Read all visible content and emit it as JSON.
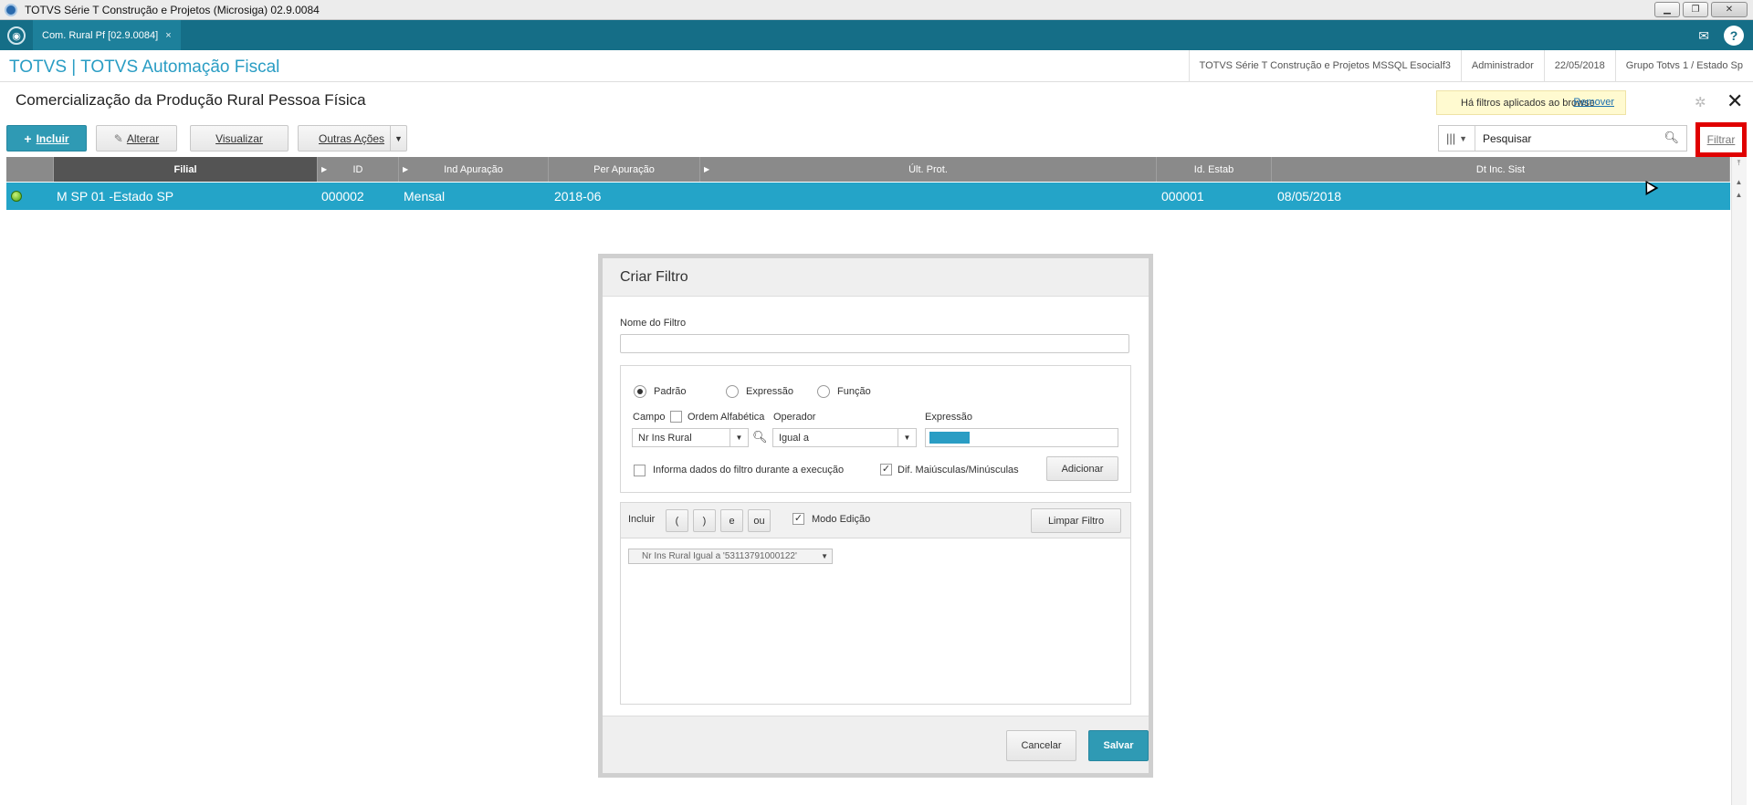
{
  "window": {
    "title": "TOTVS Série T Construção e Projetos (Microsiga) 02.9.0084"
  },
  "tabbar": {
    "tab_label": "Com. Rural Pf [02.9.0084]",
    "tab_close": "×",
    "mail_icon": "mail-icon",
    "help_label": "?"
  },
  "header": {
    "brand": "TOTVS | TOTVS Automação Fiscal",
    "info": [
      "TOTVS Série T Construção e Projetos MSSQL Esocialf3",
      "Administrador",
      "22/05/2018",
      "Grupo Totvs 1 / Estado Sp"
    ]
  },
  "page": {
    "title": "Comercialização da Produção Rural Pessoa Física",
    "filter_notice": "Há filtros aplicados ao browse",
    "remove_label": "Remover",
    "close_glyph": "✕"
  },
  "toolbar": {
    "include_label": "Incluir",
    "include_plus": "+",
    "alter_label": "Alterar",
    "view_label": "Visualizar",
    "other_label": "Outras Ações",
    "search_placeholder": "Pesquisar",
    "filter_label": "Filtrar"
  },
  "grid": {
    "columns": [
      "Filial",
      "ID",
      "Ind Apuração",
      "Per Apuração",
      "Últ. Prot.",
      "Id. Estab",
      "Dt Inc. Sist"
    ],
    "rows": [
      {
        "filial": "M SP 01 -Estado SP",
        "id": "000002",
        "ind_apuracao": "Mensal",
        "per_apuracao": "2018-06",
        "ult_prot": "",
        "id_estab": "000001",
        "dt_inc_sist": "08/05/2018",
        "status_color": "#4aa10c"
      }
    ]
  },
  "modal": {
    "title": "Criar Filtro",
    "name_label": "Nome do Filtro",
    "name_value": "",
    "radio_padrao": "Padrão",
    "radio_expressao": "Expressão",
    "radio_funcao": "Função",
    "campo_label": "Campo",
    "ordem_label": "Ordem Alfabética",
    "operador_label": "Operador",
    "expressao_label": "Expressão",
    "campo_value": "Nr Ins Rural",
    "operador_value": "Igual a",
    "expressao_value": "",
    "informa_label": "Informa dados do filtro durante a execução",
    "dif_label": "Dif. Maiúsculas/Minúsculas",
    "adicionar_label": "Adicionar",
    "incluir_label": "Incluir",
    "paren_open": "(",
    "paren_close": ")",
    "and_label": "e",
    "or_label": "ou",
    "modo_label": "Modo Edição",
    "limpar_label": "Limpar Filtro",
    "chip_label": "Nr Ins Rural Igual a '53113791000122'",
    "cancel_label": "Cancelar",
    "save_label": "Salvar"
  },
  "colors": {
    "accent": "#2f9ab4",
    "tabbar": "#156e87",
    "selected_row": "#24a4c8",
    "brand": "#2a9dc4",
    "highlight": "#e00000"
  }
}
